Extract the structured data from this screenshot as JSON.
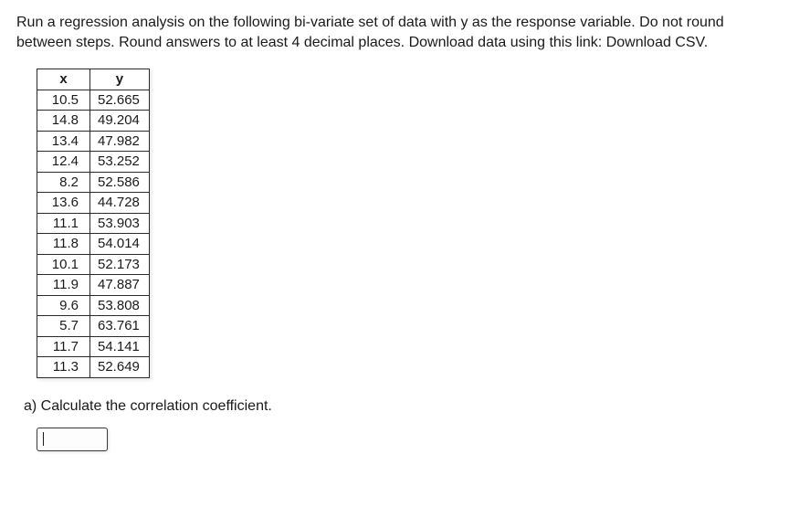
{
  "question": {
    "intro_part1": "Run a regression analysis on the following bi-variate set of data with y as the response variable. Do not round between steps. Round answers to at least 4 decimal places. Download data using this link: ",
    "link_text": "Download CSV",
    "intro_part2": "."
  },
  "table": {
    "header_x": "x",
    "header_y": "y",
    "rows": [
      {
        "x": "10.5",
        "y": "52.665"
      },
      {
        "x": "14.8",
        "y": "49.204"
      },
      {
        "x": "13.4",
        "y": "47.982"
      },
      {
        "x": "12.4",
        "y": "53.252"
      },
      {
        "x": "8.2",
        "y": "52.586"
      },
      {
        "x": "13.6",
        "y": "44.728"
      },
      {
        "x": "11.1",
        "y": "53.903"
      },
      {
        "x": "11.8",
        "y": "54.014"
      },
      {
        "x": "10.1",
        "y": "52.173"
      },
      {
        "x": "11.9",
        "y": "47.887"
      },
      {
        "x": "9.6",
        "y": "53.808"
      },
      {
        "x": "5.7",
        "y": "63.761"
      },
      {
        "x": "11.7",
        "y": "54.141"
      },
      {
        "x": "11.3",
        "y": "52.649"
      }
    ]
  },
  "part_a": {
    "label": "a) Calculate the correlation coefficient.",
    "input_value": ""
  },
  "chart_data": {
    "type": "table",
    "columns": [
      "x",
      "y"
    ],
    "data": [
      [
        10.5,
        52.665
      ],
      [
        14.8,
        49.204
      ],
      [
        13.4,
        47.982
      ],
      [
        12.4,
        53.252
      ],
      [
        8.2,
        52.586
      ],
      [
        13.6,
        44.728
      ],
      [
        11.1,
        53.903
      ],
      [
        11.8,
        54.014
      ],
      [
        10.1,
        52.173
      ],
      [
        11.9,
        47.887
      ],
      [
        9.6,
        53.808
      ],
      [
        5.7,
        63.761
      ],
      [
        11.7,
        54.141
      ],
      [
        11.3,
        52.649
      ]
    ]
  }
}
